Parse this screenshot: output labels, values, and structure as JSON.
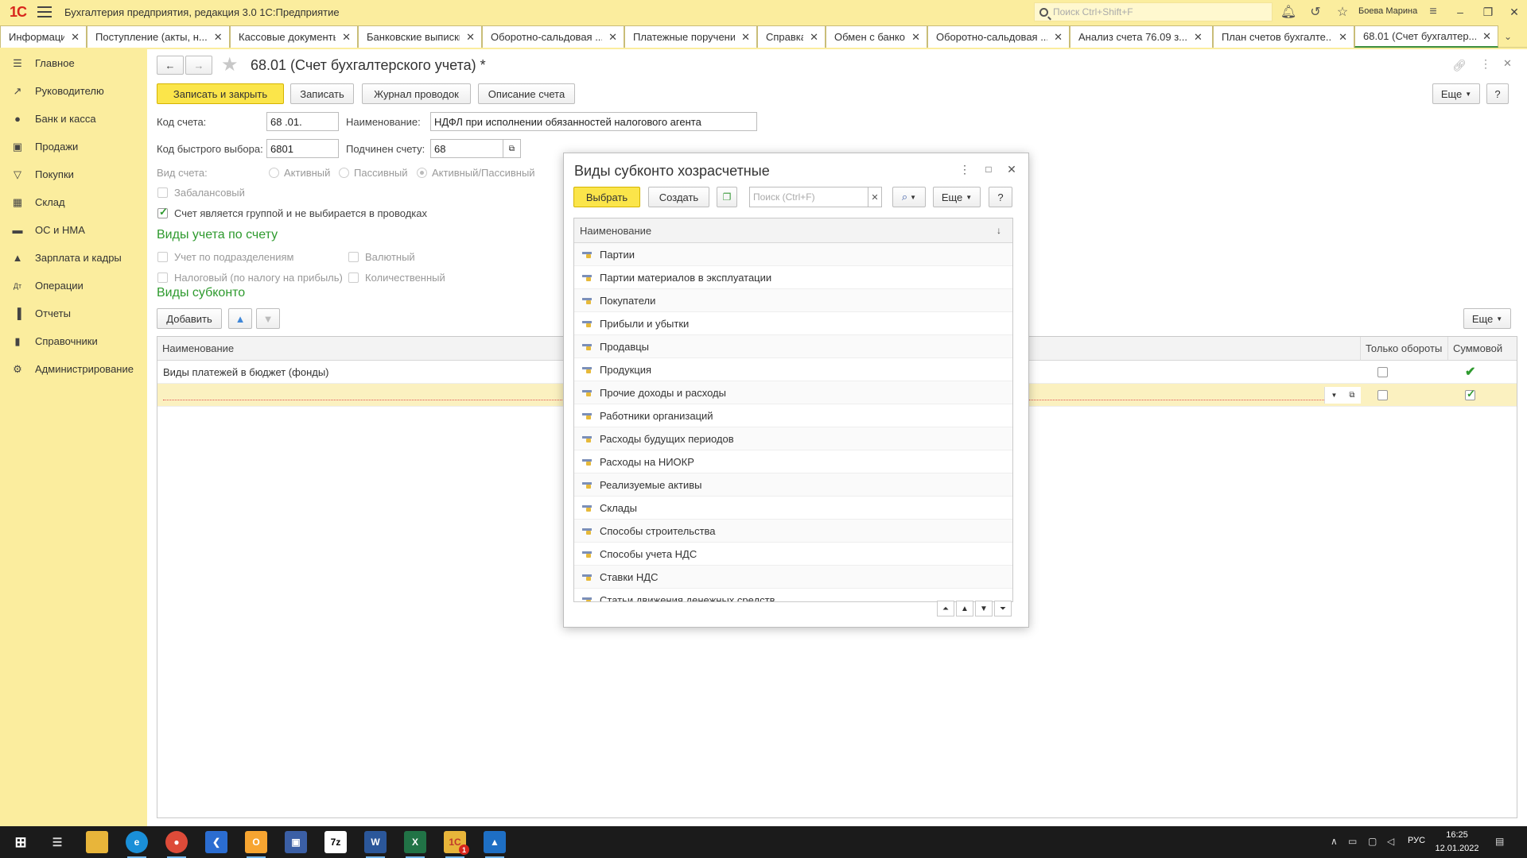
{
  "titlebar": {
    "logo": "1С",
    "app_title": "Бухгалтерия предприятия, редакция 3.0 1С:Предприятие",
    "search_placeholder": "Поиск Ctrl+Shift+F",
    "user": "Боева Марина"
  },
  "tabs": [
    {
      "label": "Информация",
      "active": false
    },
    {
      "label": "Поступление (акты, н...",
      "active": false
    },
    {
      "label": "Кассовые документы",
      "active": false
    },
    {
      "label": "Банковские выписки",
      "active": false
    },
    {
      "label": "Оборотно-сальдовая ...",
      "active": false
    },
    {
      "label": "Платежные поручения",
      "active": false
    },
    {
      "label": "Справка",
      "active": false
    },
    {
      "label": "Обмен с банком",
      "active": false
    },
    {
      "label": "Оборотно-сальдовая ...",
      "active": false
    },
    {
      "label": "Анализ счета 76.09 з...",
      "active": false
    },
    {
      "label": "План счетов бухгалте...",
      "active": false
    },
    {
      "label": "68.01 (Счет бухгалтер...",
      "active": true
    }
  ],
  "sidebar": {
    "items": [
      {
        "label": "Главное",
        "icon": "menu-icon"
      },
      {
        "label": "Руководителю",
        "icon": "trend-icon"
      },
      {
        "label": "Банк и касса",
        "icon": "coin-icon"
      },
      {
        "label": "Продажи",
        "icon": "bag-icon"
      },
      {
        "label": "Покупки",
        "icon": "cart-icon"
      },
      {
        "label": "Склад",
        "icon": "warehouse-icon"
      },
      {
        "label": "ОС и НМА",
        "icon": "car-icon"
      },
      {
        "label": "Зарплата и кадры",
        "icon": "person-icon"
      },
      {
        "label": "Операции",
        "icon": "dt-kt-icon"
      },
      {
        "label": "Отчеты",
        "icon": "bars-icon"
      },
      {
        "label": "Справочники",
        "icon": "book-icon"
      },
      {
        "label": "Администрирование",
        "icon": "gear-icon"
      }
    ]
  },
  "form": {
    "title": "68.01 (Счет бухгалтерского учета) *",
    "buttons": {
      "save_close": "Записать и закрыть",
      "save": "Записать",
      "journal": "Журнал проводок",
      "description": "Описание счета",
      "more": "Еще",
      "help": "?"
    },
    "fields": {
      "code_label": "Код счета:",
      "code_value": "68 .01.",
      "name_label": "Наименование:",
      "name_value": "НДФЛ при исполнении обязанностей налогового агента",
      "quick_label": "Код быстрого выбора:",
      "quick_value": "6801",
      "parent_label": "Подчинен счету:",
      "parent_value": "68",
      "type_label": "Вид счета:",
      "type_active": "Активный",
      "type_passive": "Пассивный",
      "type_ap": "Активный/Пассивный",
      "offbalance": "Забалансовый",
      "is_group": "Счет является группой и не выбирается в проводках"
    },
    "accounting_types": {
      "heading": "Виды учета по счету",
      "by_division": "Учет по подразделениям",
      "currency": "Валютный",
      "tax": "Налоговый (по налогу на прибыль)",
      "quantity": "Количественный"
    },
    "subconto": {
      "heading": "Виды субконто",
      "add": "Добавить",
      "more": "Еще",
      "col_name": "Наименование",
      "col_turnover": "Только обороты",
      "col_sum": "Суммовой",
      "rows": [
        {
          "name": "Виды платежей в бюджет (фонды)",
          "turnover": false,
          "sum": true
        },
        {
          "name": "",
          "turnover": false,
          "sum": true
        }
      ]
    }
  },
  "dialog": {
    "title": "Виды субконто хозрасчетные",
    "select": "Выбрать",
    "create": "Создать",
    "search_placeholder": "Поиск (Ctrl+F)",
    "more": "Еще",
    "help": "?",
    "col_name": "Наименование",
    "items": [
      "Партии",
      "Партии материалов в эксплуатации",
      "Покупатели",
      "Прибыли и убытки",
      "Продавцы",
      "Продукция",
      "Прочие доходы и расходы",
      "Работники организаций",
      "Расходы будущих периодов",
      "Расходы на НИОКР",
      "Реализуемые активы",
      "Склады",
      "Способы строительства",
      "Способы учета НДС",
      "Ставки НДС",
      "Статьи движения денежных средств"
    ]
  },
  "taskbar": {
    "lang": "РУС",
    "time": "16:25",
    "date": "12.01.2022",
    "badge": "1"
  }
}
